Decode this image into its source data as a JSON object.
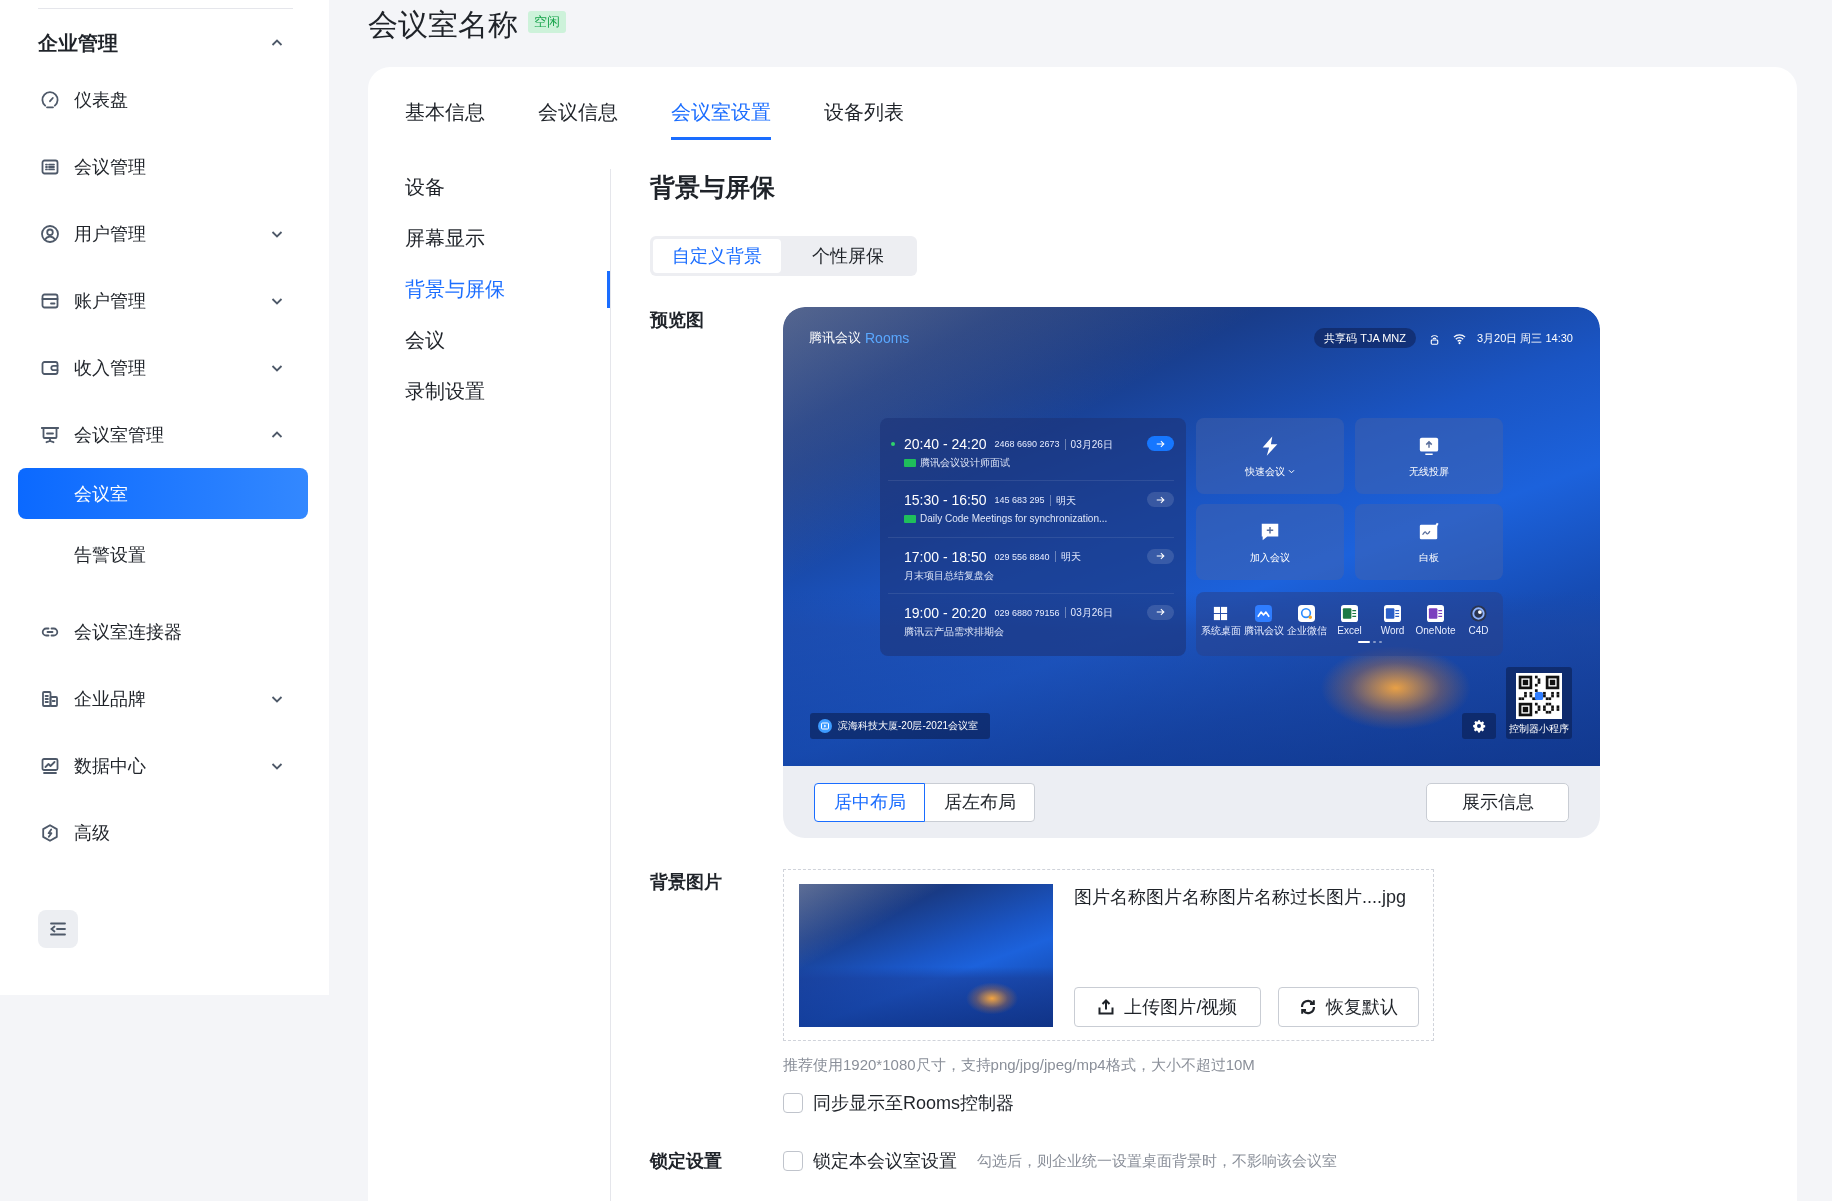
{
  "sidebar": {
    "section": {
      "label": "企业管理",
      "expanded": true
    },
    "items": [
      {
        "kind": "link",
        "label": "仪表盘",
        "selected": false
      },
      {
        "kind": "link",
        "label": "会议管理",
        "selected": false
      },
      {
        "kind": "group",
        "label": "用户管理",
        "expanded": false
      },
      {
        "kind": "group",
        "label": "账户管理",
        "expanded": false
      },
      {
        "kind": "group",
        "label": "收入管理",
        "expanded": false
      },
      {
        "kind": "group",
        "label": "会议室管理",
        "expanded": true,
        "children": [
          {
            "label": "会议室",
            "selected": true
          },
          {
            "label": "告警设置",
            "selected": false
          }
        ]
      },
      {
        "kind": "link",
        "label": "会议室连接器",
        "selected": false
      },
      {
        "kind": "group",
        "label": "企业品牌",
        "expanded": false
      },
      {
        "kind": "group",
        "label": "数据中心",
        "expanded": false
      },
      {
        "kind": "link",
        "label": "高级",
        "selected": false
      }
    ]
  },
  "header": {
    "title": "会议室名称",
    "status": "空闲"
  },
  "tabs": [
    {
      "label": "基本信息",
      "selected": false
    },
    {
      "label": "会议信息",
      "selected": false
    },
    {
      "label": "会议室设置",
      "selected": true
    },
    {
      "label": "设备列表",
      "selected": false
    }
  ],
  "subnav": [
    {
      "label": "设备",
      "selected": false
    },
    {
      "label": "屏幕显示",
      "selected": false
    },
    {
      "label": "背景与屏保",
      "selected": true
    },
    {
      "label": "会议",
      "selected": false
    },
    {
      "label": "录制设置",
      "selected": false
    }
  ],
  "section_title": "背景与屏保",
  "mode_tabs": [
    {
      "label": "自定义背景",
      "selected": true
    },
    {
      "label": "个性屏保",
      "selected": false
    }
  ],
  "preview": {
    "label": "预览图",
    "screen": {
      "brand": "腾讯会议",
      "brand_suffix": "Rooms",
      "share_code": "共享码 TJA MNZ",
      "datetime": "3月20日 周三 14:30",
      "meetings": [
        {
          "time": "20:40 - 24:20",
          "number": "2468 6690 2673",
          "date": "03月26日",
          "title": "腾讯会议设计师面试",
          "tagged": true,
          "current": true
        },
        {
          "time": "15:30 - 16:50",
          "number": "145 683 295",
          "date": "明天",
          "title": "Daily Code Meetings for synchronization...",
          "tagged": true,
          "current": false
        },
        {
          "time": "17:00 - 18:50",
          "number": "029 556 8840",
          "date": "明天",
          "title": "月末项目总结复盘会",
          "tagged": false,
          "current": false
        },
        {
          "time": "19:00 - 20:20",
          "number": "029 6880 79156",
          "date": "03月26日",
          "title": "腾讯云产品需求排期会",
          "tagged": false,
          "current": false
        }
      ],
      "actions": [
        {
          "label": "快速会议",
          "dropdown": true
        },
        {
          "label": "无线投屏",
          "dropdown": false
        },
        {
          "label": "加入会议",
          "dropdown": false
        },
        {
          "label": "白板",
          "dropdown": false
        }
      ],
      "apps": [
        "系统桌面",
        "腾讯会议",
        "企业微信",
        "Excel",
        "Word",
        "OneNote",
        "C4D"
      ],
      "app_pages": [
        {
          "selected": true
        },
        {
          "selected": false
        },
        {
          "selected": false
        }
      ],
      "location": "滨海科技大厦-20层-2021会议室",
      "qr_caption": "控制器小程序"
    },
    "layout_options": [
      {
        "label": "居中布局",
        "selected": true
      },
      {
        "label": "居左布局",
        "selected": false
      }
    ],
    "info_button": "展示信息"
  },
  "background": {
    "label": "背景图片",
    "file_name": "图片名称图片名称图片名称过长图片....jpg",
    "upload_button": "上传图片/视频",
    "reset_button": "恢复默认",
    "hint": "推荐使用1920*1080尺寸，支持png/jpg/jpeg/mp4格式，大小不超过10M",
    "sync": {
      "label": "同步显示至Rooms控制器",
      "checked": false
    }
  },
  "lock": {
    "label": "锁定设置",
    "option": {
      "label": "锁定本会议室设置",
      "checked": false
    },
    "hint": "勾选后，则企业统一设置桌面背景时，不影响该会议室"
  }
}
